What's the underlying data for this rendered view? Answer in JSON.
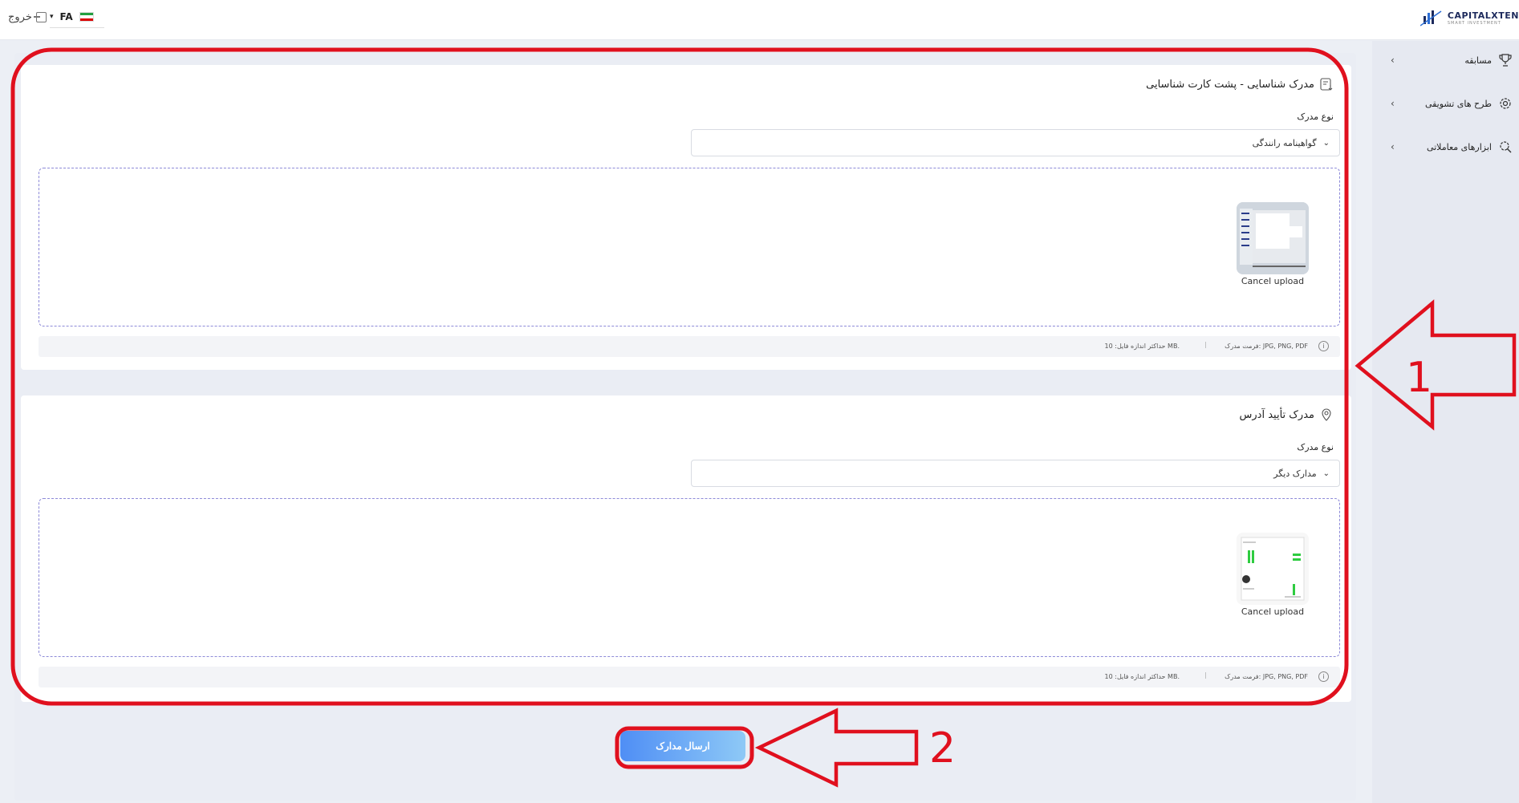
{
  "header": {
    "logout_label": "خروج",
    "language": "FA",
    "brand": "CAPITALXTEN",
    "brand_sub": "SMART INVESTMENT"
  },
  "sidebar": {
    "items": [
      {
        "label": "مسابقه",
        "icon": "trophy-icon"
      },
      {
        "label": "طرح های تشویقی",
        "icon": "incentive-gear-icon"
      },
      {
        "label": "ابزارهای معاملاتی",
        "icon": "trading-tools-icon"
      }
    ]
  },
  "sections": [
    {
      "title": "مدرک شناسایی - پشت کارت شناسایی",
      "icon": "document-upload-icon",
      "field_label": "نوع مدرک",
      "selected": "گواهینامه رانندگی",
      "cancel_label": "Cancel upload",
      "info_format": "فرمت مدرک: JPG, PNG, PDF",
      "info_size": "حداکثر اندازه فایل: 10 MB."
    },
    {
      "title": "مدرک تأیید آدرس",
      "icon": "location-pin-icon",
      "field_label": "نوع مدرک",
      "selected": "مدارک دیگر",
      "cancel_label": "Cancel upload",
      "info_format": "فرمت مدرک: JPG, PNG, PDF",
      "info_size": "حداکثر اندازه فایل: 10 MB."
    }
  ],
  "submit_label": "ارسال مدارک",
  "annotations": {
    "label_1": "1",
    "label_2": "2",
    "color": "#e0101e"
  }
}
